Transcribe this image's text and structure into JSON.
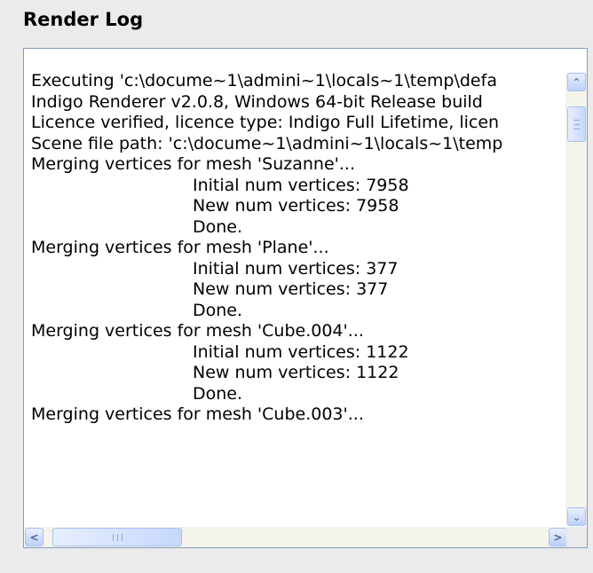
{
  "panel": {
    "title": "Render Log"
  },
  "log": {
    "lines": [
      {
        "text": "Executing 'c:\\docume~1\\admini~1\\locals~1\\temp\\defa",
        "indent": false
      },
      {
        "text": "Indigo Renderer v2.0.8, Windows 64-bit Release build",
        "indent": false
      },
      {
        "text": "Licence verified, licence type: Indigo Full Lifetime, licen",
        "indent": false
      },
      {
        "text": "Scene file path: 'c:\\docume~1\\admini~1\\locals~1\\temp",
        "indent": false
      },
      {
        "text": "Merging vertices for mesh 'Suzanne'...",
        "indent": false
      },
      {
        "text": "Initial num vertices: 7958",
        "indent": true
      },
      {
        "text": "New num vertices: 7958",
        "indent": true
      },
      {
        "text": "Done.",
        "indent": true
      },
      {
        "text": "Merging vertices for mesh 'Plane'...",
        "indent": false
      },
      {
        "text": "Initial num vertices: 377",
        "indent": true
      },
      {
        "text": "New num vertices: 377",
        "indent": true
      },
      {
        "text": "Done.",
        "indent": true
      },
      {
        "text": "Merging vertices for mesh 'Cube.004'...",
        "indent": false
      },
      {
        "text": "Initial num vertices: 1122",
        "indent": true
      },
      {
        "text": "New num vertices: 1122",
        "indent": true
      },
      {
        "text": "Done.",
        "indent": true
      },
      {
        "text": "Merging vertices for mesh 'Cube.003'...",
        "indent": false
      }
    ]
  },
  "scrollbars": {
    "up_icon": "chevron-up-icon",
    "down_icon": "chevron-down-icon",
    "left_icon": "chevron-left-icon",
    "right_icon": "chevron-right-icon",
    "up_glyph": "⌃",
    "down_glyph": "⌄",
    "left_glyph": "<",
    "right_glyph": ">"
  },
  "colors": {
    "background": "#ebebeb",
    "log_background": "#ffffff",
    "border": "#7f9db9",
    "scroll_button": "#bdd0fb"
  }
}
